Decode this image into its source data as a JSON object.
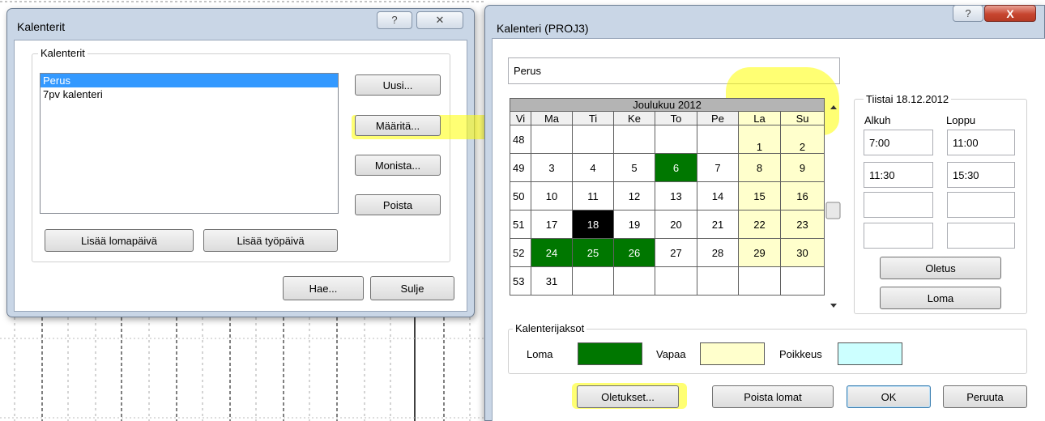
{
  "colors": {
    "holiday": "#007700",
    "free": "#ffffcc",
    "exception": "#ccffff",
    "highlight": "#ffff00",
    "selection": "#3399ff"
  },
  "win1": {
    "title": "Kalenterit",
    "help_icon": "?",
    "close_icon": "✕",
    "group_label": "Kalenterit",
    "calendars": [
      "Perus",
      "7pv kalenteri"
    ],
    "selected_index": 0,
    "btn_new": "Uusi...",
    "btn_define": "Määritä...",
    "btn_copy": "Monista...",
    "btn_delete": "Poista",
    "btn_add_holiday": "Lisää lomapäivä",
    "btn_add_workday": "Lisää työpäivä",
    "btn_fetch": "Hae...",
    "btn_close": "Sulje"
  },
  "win2": {
    "title": "Kalenteri (PROJ3)",
    "help_icon": "?",
    "close_icon": "X",
    "name_value": "Perus",
    "month_title": "Joulukuu 2012",
    "week_header": "Vi",
    "day_headers": [
      "Ma",
      "Ti",
      "Ke",
      "To",
      "Pe",
      "La",
      "Su"
    ],
    "weeks": [
      {
        "wk": "48",
        "days": [
          "",
          "",
          "",
          "",
          "",
          "1",
          "2"
        ]
      },
      {
        "wk": "49",
        "days": [
          "3",
          "4",
          "5",
          "6",
          "7",
          "8",
          "9"
        ]
      },
      {
        "wk": "50",
        "days": [
          "10",
          "11",
          "12",
          "13",
          "14",
          "15",
          "16"
        ]
      },
      {
        "wk": "51",
        "days": [
          "17",
          "18",
          "19",
          "20",
          "21",
          "22",
          "23"
        ]
      },
      {
        "wk": "52",
        "days": [
          "24",
          "25",
          "26",
          "27",
          "28",
          "29",
          "30"
        ]
      },
      {
        "wk": "53",
        "days": [
          "31",
          "",
          "",
          "",
          "",
          "",
          ""
        ]
      }
    ],
    "holidays": [
      "6",
      "24",
      "25",
      "26"
    ],
    "selected_day": "18",
    "day_panel": {
      "title": "Tiistai 18.12.2012",
      "start_label": "Alkuh",
      "end_label": "Loppu",
      "rows": [
        [
          "7:00",
          "11:00"
        ],
        [
          "11:30",
          "15:30"
        ],
        [
          "",
          ""
        ],
        [
          "",
          ""
        ]
      ],
      "btn_default": "Oletus",
      "btn_holiday": "Loma"
    },
    "periods": {
      "group_label": "Kalenterijaksot",
      "holiday_label": "Loma",
      "free_label": "Vapaa",
      "exception_label": "Poikkeus"
    },
    "btn_defaults": "Oletukset...",
    "btn_remove_holidays": "Poista lomat",
    "btn_ok": "OK",
    "btn_cancel": "Peruuta"
  }
}
